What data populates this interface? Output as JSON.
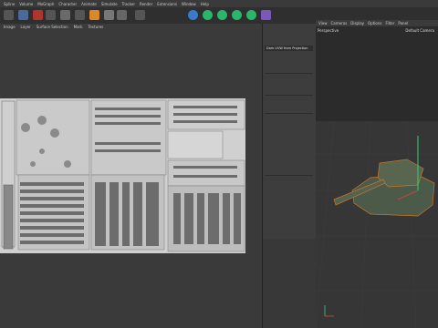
{
  "menubar": {
    "items": [
      "Spline",
      "Volume",
      "MoGraph",
      "Character",
      "Animate",
      "Simulate",
      "Tracker",
      "Render",
      "Extensions",
      "Window",
      "Help"
    ]
  },
  "uv_editor": {
    "menu_items": [
      "Image",
      "Layer",
      "Surface Selection",
      "Mark",
      "Textures"
    ]
  },
  "layers_panel": {
    "selected_row": "Dark UVW from Projection"
  },
  "viewport": {
    "menu_items": [
      "View",
      "Cameras",
      "Display",
      "Options",
      "Filter",
      "Panel"
    ],
    "label": "Perspective",
    "camera": "Default Camera",
    "colors": {
      "background": "#2b2b2b",
      "floor": "#363636",
      "grid": "#3e3e3e",
      "model": "#4c5a4a",
      "outline": "#c8782a",
      "axis_y": "#2fd37a",
      "axis_x": "#d04a3a"
    }
  },
  "toolbar": {
    "icons": [
      "move-icon",
      "scale-icon",
      "rotate-icon",
      "select-icon",
      "object-icon",
      "render-icon",
      "render-view-icon",
      "render-settings-icon",
      "cube-icon",
      "pen-icon",
      "subdivide-icon",
      "array-icon",
      "deformer-icon",
      "generator-icon",
      "camera-icon",
      "light-icon"
    ]
  }
}
